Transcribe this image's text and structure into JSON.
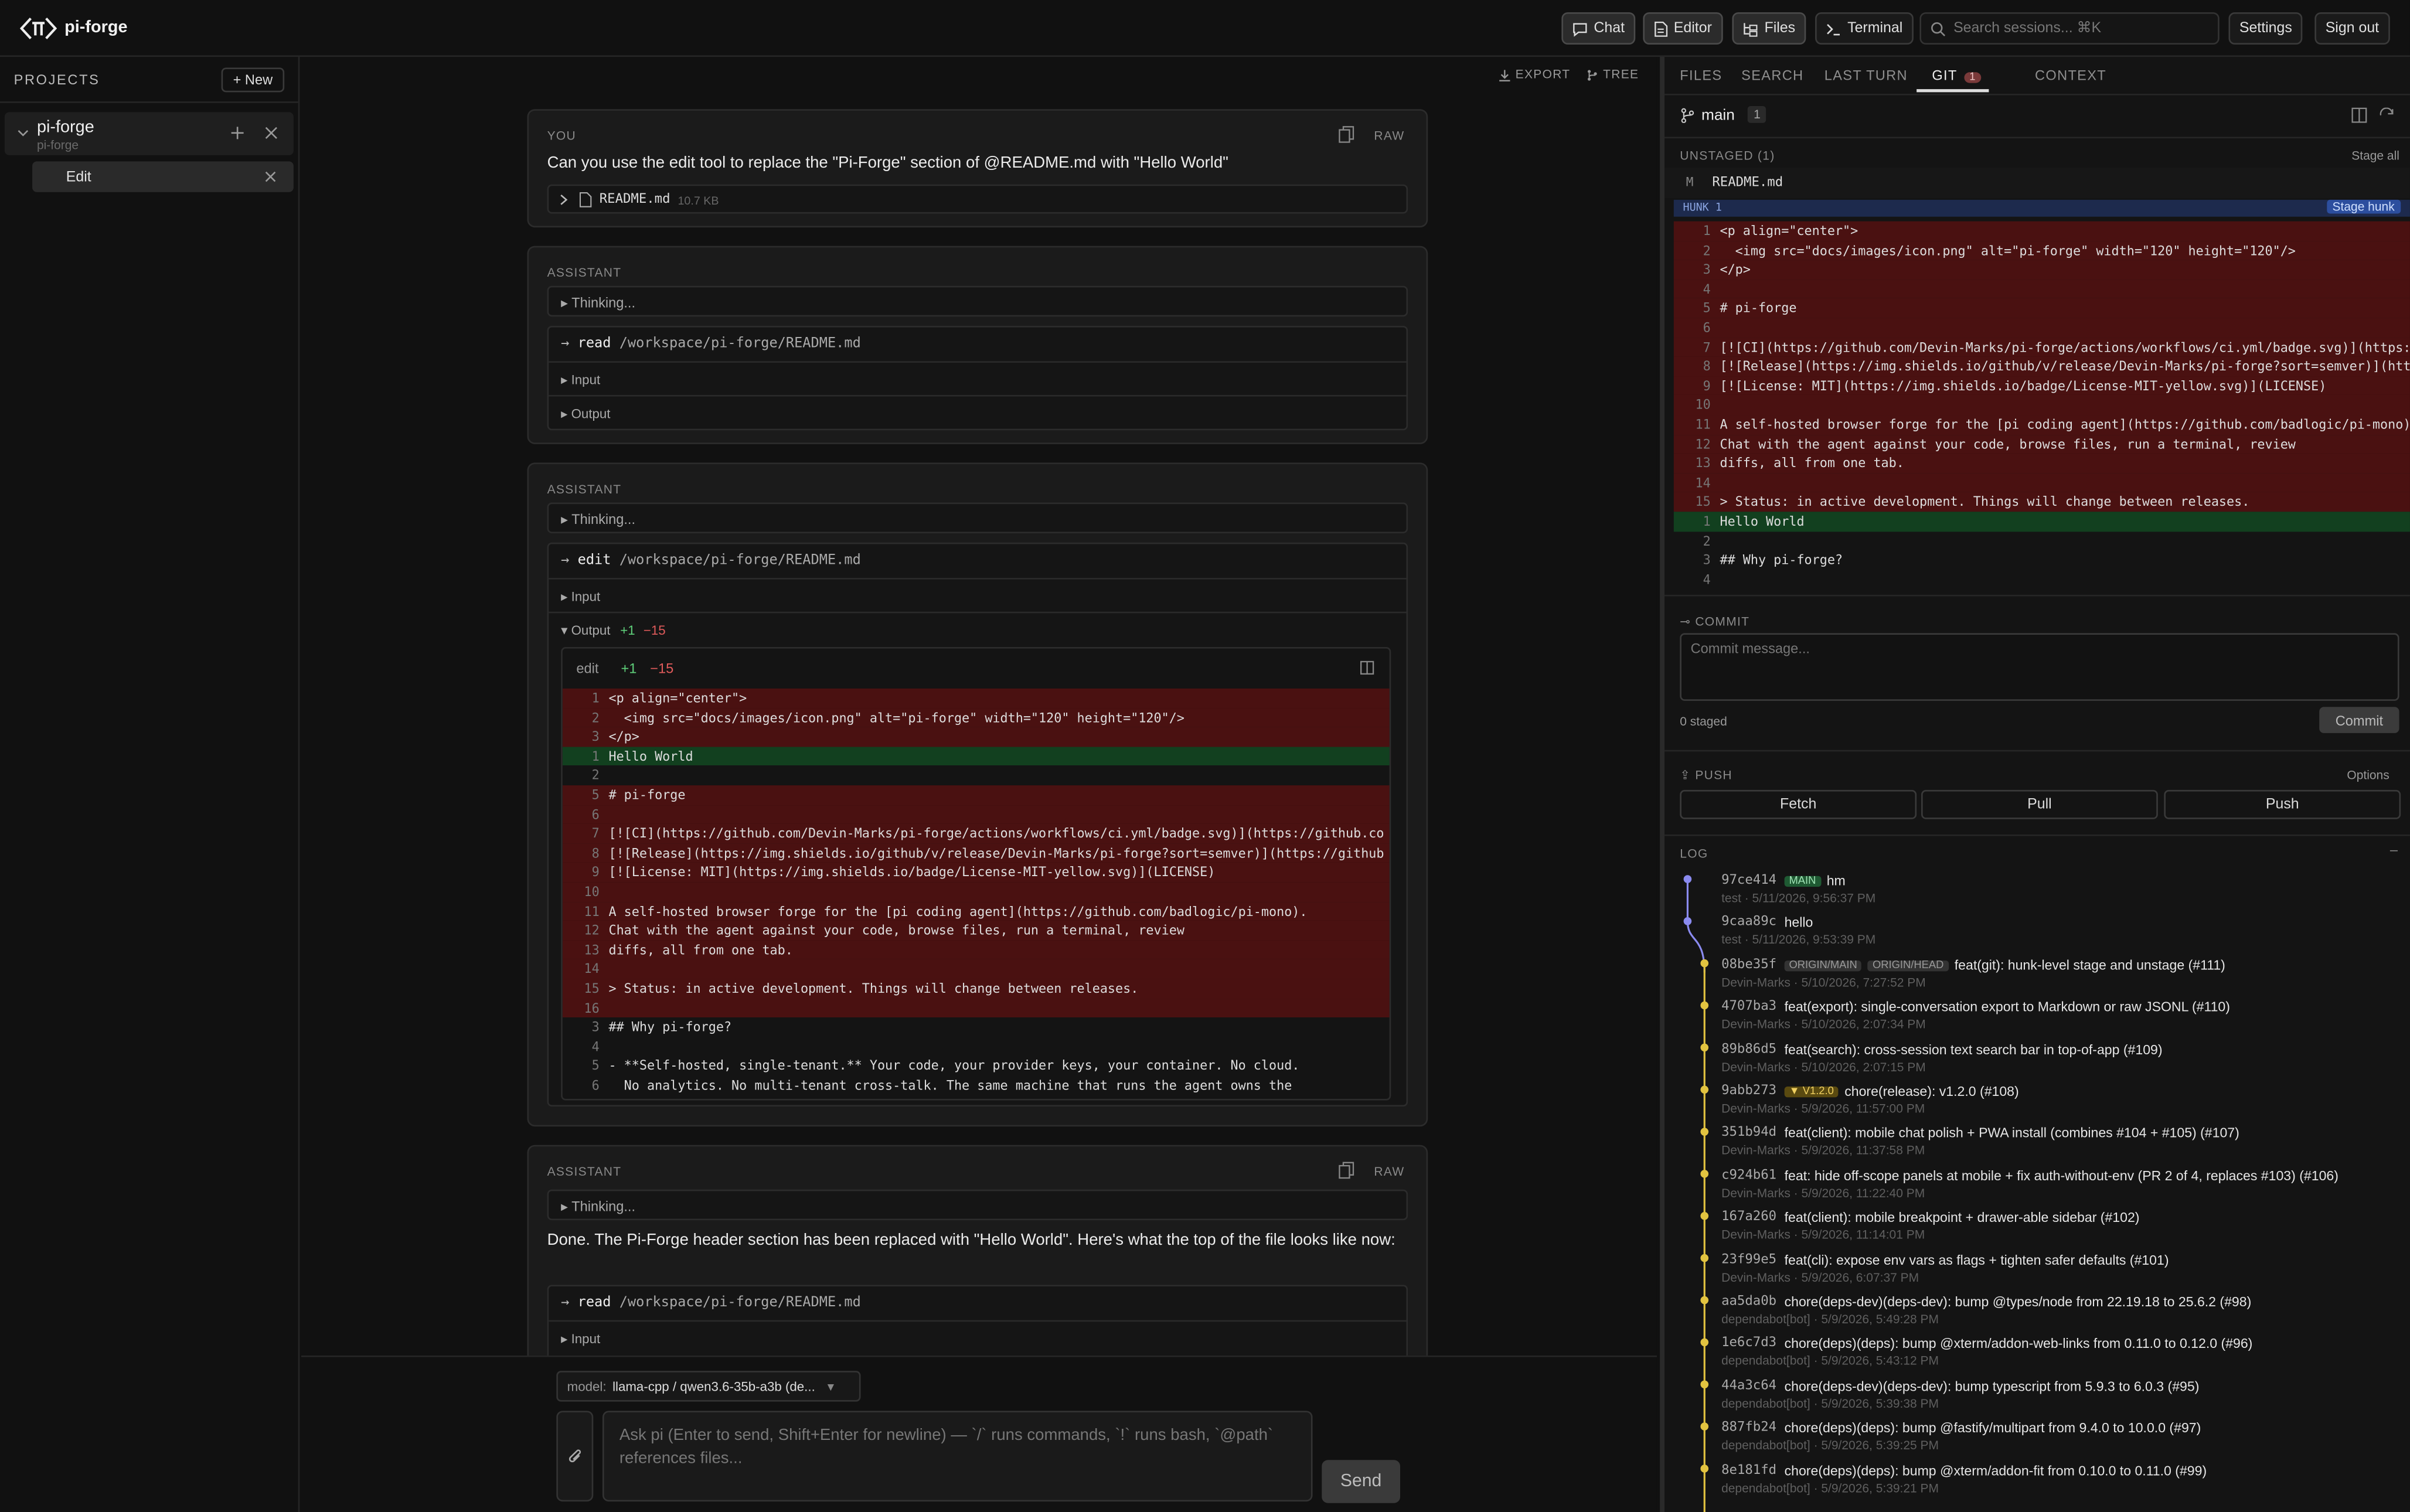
{
  "header": {
    "brand": "pi-forge",
    "buttons": [
      "Chat",
      "Editor",
      "Files",
      "Terminal"
    ],
    "search_placeholder": "Search sessions... ⌘K",
    "settings": "Settings",
    "signout": "Sign out"
  },
  "sidebar": {
    "title": "PROJECTS",
    "new_label": "+ New",
    "project_name": "pi-forge",
    "project_sub": "pi-forge",
    "session_label": "Edit"
  },
  "chat": {
    "export": "EXPORT",
    "tree": "TREE",
    "user_label": "YOU",
    "raw": "RAW",
    "user_text": "Can you use the edit tool to replace the \"Pi-Forge\" section of @README.md with \"Hello World\"",
    "attachment_name": "README.md",
    "attachment_size": "10.7 KB",
    "assistant_label": "ASSISTANT",
    "thinking": "Thinking...",
    "input": "Input",
    "output": "Output",
    "tool1_name": "read",
    "tool1_path": "/workspace/pi-forge/README.md",
    "tool2_name": "edit",
    "tool2_path": "/workspace/pi-forge/README.md",
    "plus": "+1",
    "minus": "−15",
    "diff_title": "edit",
    "diff_lines": [
      {
        "n": "1",
        "t": "del",
        "c": "<p align=\"center\">"
      },
      {
        "n": "2",
        "t": "del",
        "c": "  <img src=\"docs/images/icon.png\" alt=\"pi-forge\" width=\"120\" height=\"120\"/>"
      },
      {
        "n": "3",
        "t": "del",
        "c": "</p>"
      },
      {
        "n": "1",
        "t": "add",
        "c": "Hello World"
      },
      {
        "n": "2",
        "t": "ctx",
        "c": ""
      },
      {
        "n": "5",
        "t": "del",
        "c": "# pi-forge"
      },
      {
        "n": "6",
        "t": "del",
        "c": ""
      },
      {
        "n": "7",
        "t": "del",
        "c": "[![CI](https://github.com/Devin-Marks/pi-forge/actions/workflows/ci.yml/badge.svg)](https://github.co"
      },
      {
        "n": "8",
        "t": "del",
        "c": "[![Release](https://img.shields.io/github/v/release/Devin-Marks/pi-forge?sort=semver)](https://github"
      },
      {
        "n": "9",
        "t": "del",
        "c": "[![License: MIT](https://img.shields.io/badge/License-MIT-yellow.svg)](LICENSE)"
      },
      {
        "n": "10",
        "t": "del",
        "c": ""
      },
      {
        "n": "11",
        "t": "del",
        "c": "A self-hosted browser forge for the [pi coding agent](https://github.com/badlogic/pi-mono)."
      },
      {
        "n": "12",
        "t": "del",
        "c": "Chat with the agent against your code, browse files, run a terminal, review"
      },
      {
        "n": "13",
        "t": "del",
        "c": "diffs, all from one tab."
      },
      {
        "n": "14",
        "t": "del",
        "c": ""
      },
      {
        "n": "15",
        "t": "del",
        "c": "> Status: in active development. Things will change between releases."
      },
      {
        "n": "16",
        "t": "del",
        "c": ""
      },
      {
        "n": "3",
        "t": "ctx",
        "c": "## Why pi-forge?"
      },
      {
        "n": "4",
        "t": "ctx",
        "c": ""
      },
      {
        "n": "5",
        "t": "ctx",
        "c": "- **Self-hosted, single-tenant.** Your code, your provider keys, your container. No cloud."
      },
      {
        "n": "6",
        "t": "ctx",
        "c": "  No analytics. No multi-tenant cross-talk. The same machine that runs the agent owns the"
      }
    ],
    "final_text": "Done. The Pi-Forge header section has been replaced with \"Hello World\". Here's what the top of the file looks like now:",
    "tool3_name": "read",
    "tool3_path": "/workspace/pi-forge/README.md",
    "model_label": "model:",
    "model_value": "llama-cpp / qwen3.6-35b-a3b (de...",
    "input_placeholder": "Ask pi (Enter to send, Shift+Enter for newline) — `/` runs commands, `!` runs bash, `@path` references files...",
    "send": "Send"
  },
  "right": {
    "tabs": [
      "FILES",
      "SEARCH",
      "LAST TURN",
      "GIT",
      "CONTEXT"
    ],
    "git_count": "1",
    "branch": "main",
    "branch_count": "1",
    "unstaged": "UNSTAGED (1)",
    "stage_all": "Stage all",
    "file_status": "M",
    "file_name": "README.md",
    "hunk": "HUNK 1",
    "stage_hunk": "Stage hunk",
    "hunk_lines": [
      {
        "n": "1",
        "t": "del",
        "c": "<p align=\"center\">"
      },
      {
        "n": "2",
        "t": "del",
        "c": "  <img src=\"docs/images/icon.png\" alt=\"pi-forge\" width=\"120\" height=\"120\"/>"
      },
      {
        "n": "3",
        "t": "del",
        "c": "</p>"
      },
      {
        "n": "4",
        "t": "del",
        "c": ""
      },
      {
        "n": "5",
        "t": "del",
        "c": "# pi-forge"
      },
      {
        "n": "6",
        "t": "del",
        "c": ""
      },
      {
        "n": "7",
        "t": "del",
        "c": "[![CI](https://github.com/Devin-Marks/pi-forge/actions/workflows/ci.yml/badge.svg)](https:/"
      },
      {
        "n": "8",
        "t": "del",
        "c": "[![Release](https://img.shields.io/github/v/release/Devin-Marks/pi-forge?sort=semver)](htt"
      },
      {
        "n": "9",
        "t": "del",
        "c": "[![License: MIT](https://img.shields.io/badge/License-MIT-yellow.svg)](LICENSE)"
      },
      {
        "n": "10",
        "t": "del",
        "c": ""
      },
      {
        "n": "11",
        "t": "del",
        "c": "A self-hosted browser forge for the [pi coding agent](https://github.com/badlogic/pi-mono)."
      },
      {
        "n": "12",
        "t": "del",
        "c": "Chat with the agent against your code, browse files, run a terminal, review"
      },
      {
        "n": "13",
        "t": "del",
        "c": "diffs, all from one tab."
      },
      {
        "n": "14",
        "t": "del",
        "c": ""
      },
      {
        "n": "15",
        "t": "del",
        "c": "> Status: in active development. Things will change between releases."
      },
      {
        "n": "1",
        "t": "add",
        "c": "Hello World"
      },
      {
        "n": "2",
        "t": "ctx",
        "c": ""
      },
      {
        "n": "3",
        "t": "ctx",
        "c": "## Why pi-forge?"
      },
      {
        "n": "4",
        "t": "ctx",
        "c": ""
      }
    ],
    "commit_title": "COMMIT",
    "commit_placeholder": "Commit message...",
    "staged": "0 staged",
    "commit_btn": "Commit",
    "push_title": "PUSH",
    "options": "Options",
    "fetch": "Fetch",
    "pull": "Pull",
    "push": "Push",
    "log_title": "LOG",
    "log": [
      {
        "hash": "97ce414",
        "refs": [
          "MAIN"
        ],
        "msg": "hm",
        "sub": "test · 5/11/2026, 9:56:37 PM"
      },
      {
        "hash": "9caa89c",
        "refs": [],
        "msg": "hello",
        "sub": "test · 5/11/2026, 9:53:39 PM"
      },
      {
        "hash": "08be35f",
        "refs": [
          "ORIGIN/MAIN",
          "ORIGIN/HEAD"
        ],
        "msg": "feat(git): hunk-level stage and unstage (#111)",
        "sub": "Devin-Marks · 5/10/2026, 7:27:52 PM"
      },
      {
        "hash": "4707ba3",
        "refs": [],
        "msg": "feat(export): single-conversation export to Markdown or raw JSONL (#110)",
        "sub": "Devin-Marks · 5/10/2026, 2:07:34 PM"
      },
      {
        "hash": "89b86d5",
        "refs": [],
        "msg": "feat(search): cross-session text search bar in top-of-app (#109)",
        "sub": "Devin-Marks · 5/10/2026, 2:07:15 PM"
      },
      {
        "hash": "9abb273",
        "refs": [
          "▼ V1.2.0"
        ],
        "msg": "chore(release): v1.2.0 (#108)",
        "sub": "Devin-Marks · 5/9/2026, 11:57:00 PM"
      },
      {
        "hash": "351b94d",
        "refs": [],
        "msg": "feat(client): mobile chat polish + PWA install (combines #104 + #105) (#107)",
        "sub": "Devin-Marks · 5/9/2026, 11:37:58 PM"
      },
      {
        "hash": "c924b61",
        "refs": [],
        "msg": "feat: hide off-scope panels at mobile + fix auth-without-env (PR 2 of 4, replaces #103) (#106)",
        "sub": "Devin-Marks · 5/9/2026, 11:22:40 PM"
      },
      {
        "hash": "167a260",
        "refs": [],
        "msg": "feat(client): mobile breakpoint + drawer-able sidebar (#102)",
        "sub": "Devin-Marks · 5/9/2026, 11:14:01 PM"
      },
      {
        "hash": "23f99e5",
        "refs": [],
        "msg": "feat(cli): expose env vars as flags + tighten safer defaults (#101)",
        "sub": "Devin-Marks · 5/9/2026, 6:07:37 PM"
      },
      {
        "hash": "aa5da0b",
        "refs": [],
        "msg": "chore(deps-dev)(deps-dev): bump @types/node from 22.19.18 to 25.6.2 (#98)",
        "sub": "dependabot[bot] · 5/9/2026, 5:49:28 PM"
      },
      {
        "hash": "1e6c7d3",
        "refs": [],
        "msg": "chore(deps)(deps): bump @xterm/addon-web-links from 0.11.0 to 0.12.0 (#96)",
        "sub": "dependabot[bot] · 5/9/2026, 5:43:12 PM"
      },
      {
        "hash": "44a3c64",
        "refs": [],
        "msg": "chore(deps-dev)(deps-dev): bump typescript from 5.9.3 to 6.0.3 (#95)",
        "sub": "dependabot[bot] · 5/9/2026, 5:39:38 PM"
      },
      {
        "hash": "887fb24",
        "refs": [],
        "msg": "chore(deps)(deps): bump @fastify/multipart from 9.4.0 to 10.0.0 (#97)",
        "sub": "dependabot[bot] · 5/9/2026, 5:39:25 PM"
      },
      {
        "hash": "8e181fd",
        "refs": [],
        "msg": "chore(deps)(deps): bump @xterm/addon-fit from 0.10.0 to 0.11.0 (#99)",
        "sub": "dependabot[bot] · 5/9/2026, 5:39:21 PM"
      }
    ]
  },
  "colors": {
    "bg": "#111111",
    "del": "#4a1111",
    "add": "#12401f",
    "accent_green": "#5fd07a",
    "accent_red": "#e05b5b",
    "graph_purple": "#8b8bf0",
    "graph_yellow": "#e2c340"
  }
}
